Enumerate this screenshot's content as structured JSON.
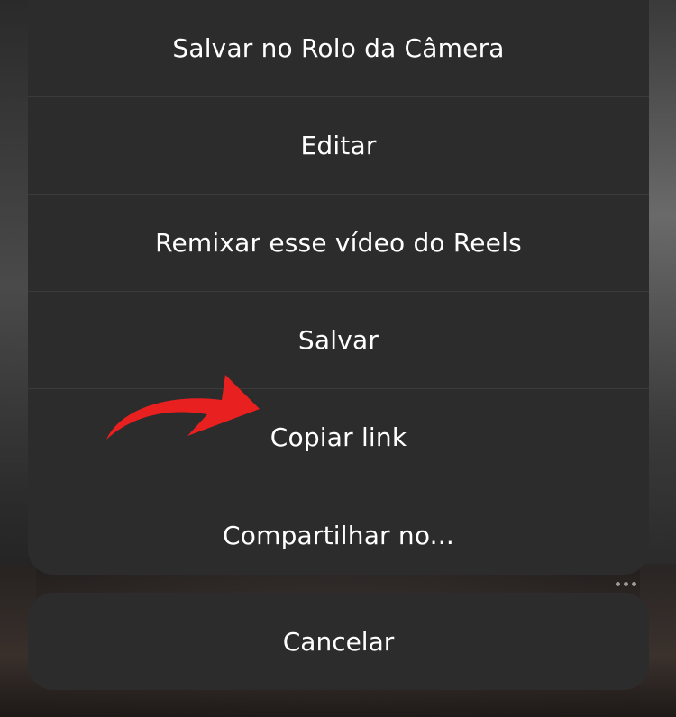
{
  "action_sheet": {
    "items": [
      {
        "label": "Salvar no Rolo da Câmera"
      },
      {
        "label": "Editar"
      },
      {
        "label": "Remixar esse vídeo do Reels"
      },
      {
        "label": "Salvar"
      },
      {
        "label": "Copiar link"
      },
      {
        "label": "Compartilhar no..."
      }
    ],
    "cancel_label": "Cancelar"
  },
  "annotation": {
    "arrow_color": "#e8201f",
    "arrow_icon": "red-arrow-pointing-right"
  },
  "colors": {
    "sheet_background": "#2c2c2c",
    "separator": "#3b3b3b",
    "text": "#ffffff"
  }
}
